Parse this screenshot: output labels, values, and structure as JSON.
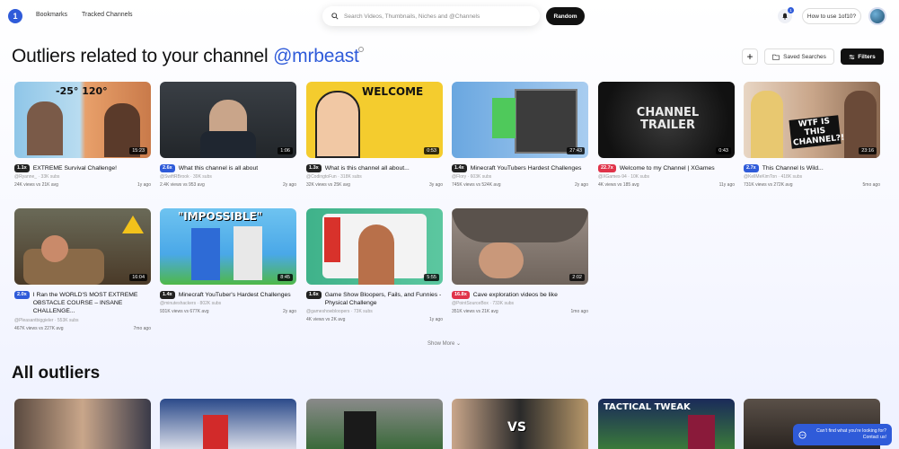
{
  "nav": {
    "logo": "1",
    "links": [
      "Bookmarks",
      "Tracked Channels"
    ],
    "search_placeholder": "Search Videos, Thumbnails, Niches and @Channels",
    "random_label": "Random",
    "notification_count": "1",
    "howto_label": "How to use 1of10?"
  },
  "header": {
    "title_prefix": "Outliers related to your channel ",
    "handle": "@mrbeast",
    "add_label": "+",
    "saved_label": "Saved Searches",
    "filters_label": "Filters"
  },
  "videos": [
    {
      "badge": "1.1x",
      "badge_color": "dark",
      "title": "EXTREME Survival Challenge!",
      "channel": "@Ryanne_ · 33K subs",
      "stats": "24K views vs 21K avg",
      "age": "1y ago",
      "duration": "15:23",
      "overlay": "-25°   120°"
    },
    {
      "badge": "2.6x",
      "badge_color": "blue",
      "title": "What this channel is all about",
      "channel": "@SwiftRBrook · 39K subs",
      "stats": "2.4K views vs 953 avg",
      "age": "2y ago",
      "duration": "1:06",
      "overlay": ""
    },
    {
      "badge": "1.3x",
      "badge_color": "dark",
      "title": "What is this channel all about...",
      "channel": "@CodingtoFun · 318K subs",
      "stats": "32K views vs 25K avg",
      "age": "3y ago",
      "duration": "0:53",
      "overlay": "WELCOME"
    },
    {
      "badge": "1.4x",
      "badge_color": "dark",
      "title": "Minecraft YouTubers Hardest Challenges",
      "channel": "@Flory · 603K subs",
      "stats": "745K views vs 524K avg",
      "age": "2y ago",
      "duration": "27:43",
      "overlay": ""
    },
    {
      "badge": "22.7x",
      "badge_color": "red",
      "title": "Welcome to my Channel | XGames",
      "channel": "@XGames-94 · 10K subs",
      "stats": "4K views vs 185 avg",
      "age": "11y ago",
      "duration": "0:43",
      "overlay": "CHANNEL TRAILER"
    },
    {
      "badge": "2.7x",
      "badge_color": "blue",
      "title": "This Channel Is Wild...",
      "channel": "@KellMeKimTon · 418K subs",
      "stats": "731K views vs 272K avg",
      "age": "5mo ago",
      "duration": "23:16",
      "overlay": "WTF IS THIS CHANNEL?!"
    },
    {
      "badge": "2.0x",
      "badge_color": "blue",
      "title": "I Ran the WORLD'S MOST EXTREME OBSTACLE COURSE – INSANE CHALLENGE...",
      "channel": "@Pleasantbiggieler · 553K subs",
      "stats": "467K views vs 227K avg",
      "age": "7mo ago",
      "duration": "16:04",
      "overlay": ""
    },
    {
      "badge": "1.4x",
      "badge_color": "dark",
      "title": "Minecraft YouTuber's Hardest Challenges",
      "channel": "@minuteshackers · 802K subs",
      "stats": "931K views vs 677K avg",
      "age": "2y ago",
      "duration": "8:45",
      "overlay": "\"IMPOSSIBLE\""
    },
    {
      "badge": "1.6x",
      "badge_color": "dark",
      "title": "Game Show Bloopers, Fails, and Funnies - Physical Challenge",
      "channel": "@gameshowbloopers · 73K subs",
      "stats": "4K views vs 2K avg",
      "age": "1y ago",
      "duration": "5:55",
      "overlay": ""
    },
    {
      "badge": "16.8x",
      "badge_color": "red",
      "title": "Cave exploration videos be like",
      "channel": "@PointSourceBox · 733K subs",
      "stats": "351K views vs 21K avg",
      "age": "1mo ago",
      "duration": "2:02",
      "overlay": ""
    }
  ],
  "show_more_label": "Show More ⌄",
  "all_outliers_title": "All outliers",
  "chat": {
    "line1": "Can't find what you're looking for?",
    "line2": "Contact us!"
  }
}
